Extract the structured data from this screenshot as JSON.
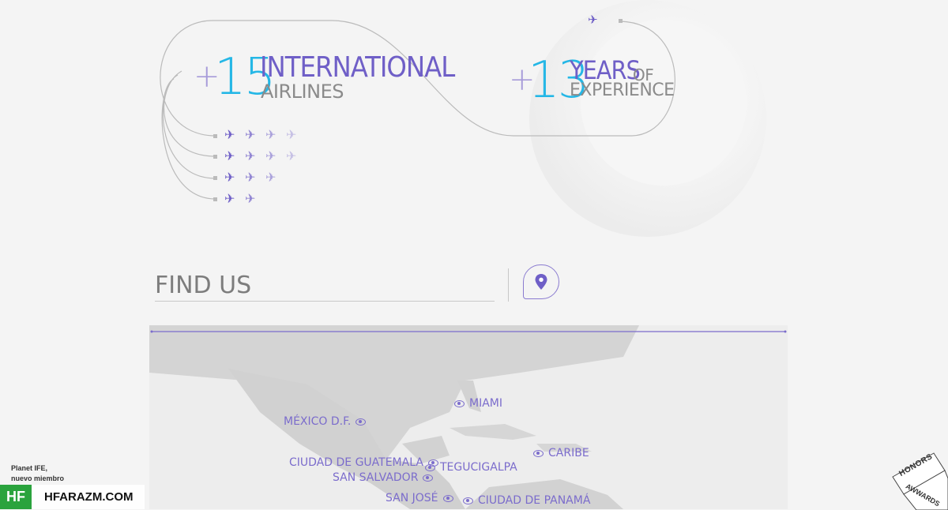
{
  "stats": {
    "airlines": {
      "plus": "+",
      "number": "15",
      "title": "INTERNATIONAL",
      "subtitle": "AIRLINES"
    },
    "years": {
      "plus": "+",
      "number": "13",
      "title": "YEARS",
      "title_suffix": "OF",
      "subtitle": "EXPERIENCE"
    }
  },
  "planes": {
    "icon": "airplane-icon",
    "rows": [
      4,
      4,
      3,
      2
    ],
    "glyph": "✈"
  },
  "find_us": {
    "title": "FIND US",
    "button_icon": "location-pin-icon"
  },
  "map": {
    "cities": [
      {
        "name": "MIAMI",
        "icon_side": "left"
      },
      {
        "name": "MÉXICO D.F.",
        "icon_side": "right"
      },
      {
        "name": "CARIBE",
        "icon_side": "left"
      },
      {
        "name": "CIUDAD DE GUATEMALA",
        "icon_side": "right"
      },
      {
        "name": "TEGUCIGALPA",
        "icon_side": "left"
      },
      {
        "name": "SAN SALVADOR",
        "icon_side": "right"
      },
      {
        "name": "SAN JOSÉ",
        "icon_side": "right"
      },
      {
        "name": "CIUDAD DE PANAMÁ",
        "icon_side": "left"
      }
    ]
  },
  "footer": {
    "planet_line1": "Planet IFE,",
    "planet_line2": "nuevo miembro",
    "watermark_logo": "HF",
    "watermark_text": "HFARAZM.COM",
    "honors_label": "HONORS",
    "honors_sub": "AWWARDS"
  },
  "colors": {
    "accent_purple": "#6f5fc7",
    "accent_blue": "#25b7e6",
    "watermark_green": "#2aa33d"
  }
}
